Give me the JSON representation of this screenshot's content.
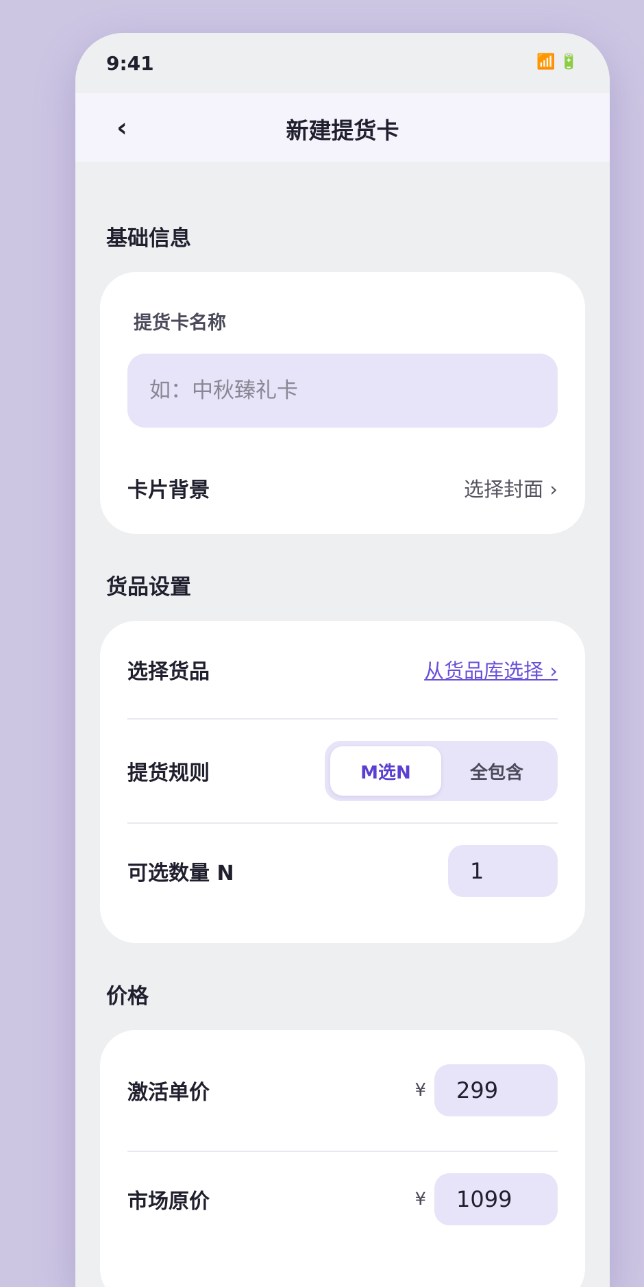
{
  "status_bar": {
    "time": "9:41",
    "signal_icon": "📶",
    "battery_icon": "🔋"
  },
  "nav": {
    "back_glyph": "‹",
    "title": "新建提货卡"
  },
  "basic_info": {
    "section_title": "基础信息",
    "name_label": "提货卡名称",
    "name_placeholder": "如：中秋臻礼卡",
    "name_value": "",
    "background_label": "卡片背景",
    "background_action": "选择封面 ›"
  },
  "goods_settings": {
    "section_title": "货品设置",
    "select_goods_label": "选择货品",
    "select_goods_action": "从货品库选择 ›",
    "rule_label": "提货规则",
    "rule_options": [
      "M选N",
      "全包含"
    ],
    "rule_selected": "M选N",
    "quantity_label": "可选数量 N",
    "quantity_value": "1"
  },
  "price": {
    "section_title": "价格",
    "activation_label": "激活单价",
    "activation_currency": "¥",
    "activation_value": "299",
    "market_label": "市场原价",
    "market_currency": "¥",
    "market_value": "1099"
  },
  "colors": {
    "page_background": "#cdc6e3",
    "screen_background": "#eeeff1",
    "accent": "#5a3fd0",
    "input_fill": "#e7e3f8"
  }
}
